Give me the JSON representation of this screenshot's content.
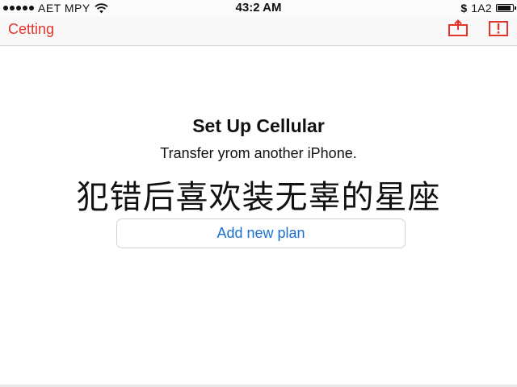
{
  "status_bar": {
    "carrier": "AET MPY",
    "time": "43:2 AM",
    "right_symbol": "$",
    "right_text": "1A2",
    "signal_icon": "signal-dots-icon",
    "wifi_icon": "wifi-icon",
    "battery_icon": "battery-icon"
  },
  "nav_bar": {
    "back_label": "Cetting",
    "share_icon": "share-icon",
    "info_icon": "info-icon",
    "accent_color": "#e3342b"
  },
  "main": {
    "title": "Set Up Cellular",
    "transfer_label": "Transfer yrom another iPhone.",
    "overlay_caption": "犯错后喜欢装无辜的星座",
    "add_plan_label": "Add new plan",
    "link_color": "#1a70d1"
  }
}
